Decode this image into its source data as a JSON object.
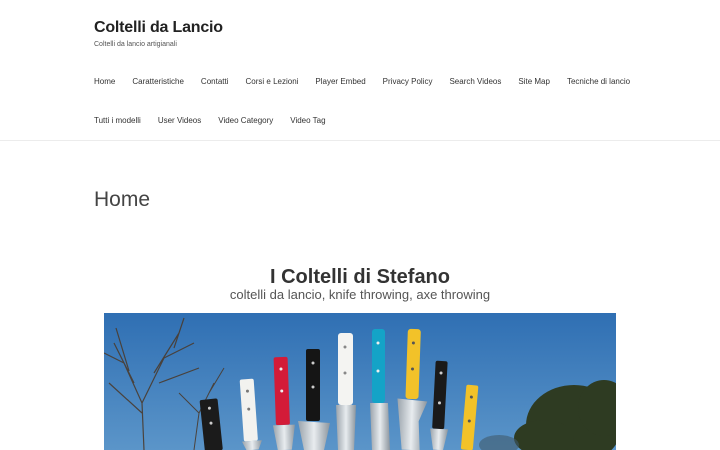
{
  "site": {
    "title": "Coltelli da Lancio",
    "tagline": "Coltelli da lancio artigianali"
  },
  "nav": {
    "row1": [
      "Home",
      "Caratteristiche",
      "Contatti",
      "Corsi e Lezioni",
      "Player Embed",
      "Privacy Policy",
      "Search Videos",
      "Site Map",
      "Tecniche di lancio"
    ],
    "row2": [
      "Tutti i modelli",
      "User Videos",
      "Video Category",
      "Video Tag"
    ]
  },
  "page": {
    "title": "Home"
  },
  "hero": {
    "title": "I Coltelli di Stefano",
    "subtitle": "coltelli da lancio, knife throwing, axe throwing"
  }
}
